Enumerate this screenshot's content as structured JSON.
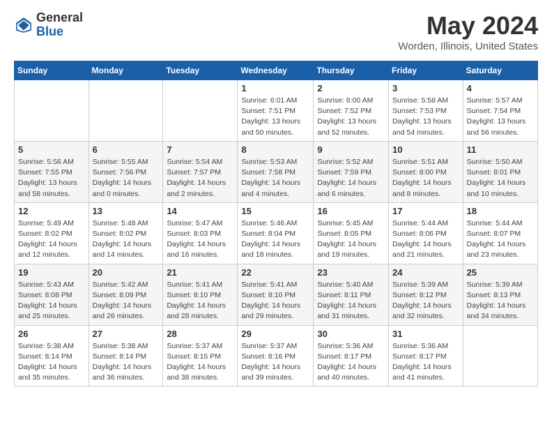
{
  "logo": {
    "general": "General",
    "blue": "Blue"
  },
  "title": "May 2024",
  "location": "Worden, Illinois, United States",
  "days_of_week": [
    "Sunday",
    "Monday",
    "Tuesday",
    "Wednesday",
    "Thursday",
    "Friday",
    "Saturday"
  ],
  "weeks": [
    [
      {
        "day": "",
        "detail": ""
      },
      {
        "day": "",
        "detail": ""
      },
      {
        "day": "",
        "detail": ""
      },
      {
        "day": "1",
        "detail": "Sunrise: 6:01 AM\nSunset: 7:51 PM\nDaylight: 13 hours\nand 50 minutes."
      },
      {
        "day": "2",
        "detail": "Sunrise: 6:00 AM\nSunset: 7:52 PM\nDaylight: 13 hours\nand 52 minutes."
      },
      {
        "day": "3",
        "detail": "Sunrise: 5:58 AM\nSunset: 7:53 PM\nDaylight: 13 hours\nand 54 minutes."
      },
      {
        "day": "4",
        "detail": "Sunrise: 5:57 AM\nSunset: 7:54 PM\nDaylight: 13 hours\nand 56 minutes."
      }
    ],
    [
      {
        "day": "5",
        "detail": "Sunrise: 5:56 AM\nSunset: 7:55 PM\nDaylight: 13 hours\nand 58 minutes."
      },
      {
        "day": "6",
        "detail": "Sunrise: 5:55 AM\nSunset: 7:56 PM\nDaylight: 14 hours\nand 0 minutes."
      },
      {
        "day": "7",
        "detail": "Sunrise: 5:54 AM\nSunset: 7:57 PM\nDaylight: 14 hours\nand 2 minutes."
      },
      {
        "day": "8",
        "detail": "Sunrise: 5:53 AM\nSunset: 7:58 PM\nDaylight: 14 hours\nand 4 minutes."
      },
      {
        "day": "9",
        "detail": "Sunrise: 5:52 AM\nSunset: 7:59 PM\nDaylight: 14 hours\nand 6 minutes."
      },
      {
        "day": "10",
        "detail": "Sunrise: 5:51 AM\nSunset: 8:00 PM\nDaylight: 14 hours\nand 8 minutes."
      },
      {
        "day": "11",
        "detail": "Sunrise: 5:50 AM\nSunset: 8:01 PM\nDaylight: 14 hours\nand 10 minutes."
      }
    ],
    [
      {
        "day": "12",
        "detail": "Sunrise: 5:49 AM\nSunset: 8:02 PM\nDaylight: 14 hours\nand 12 minutes."
      },
      {
        "day": "13",
        "detail": "Sunrise: 5:48 AM\nSunset: 8:02 PM\nDaylight: 14 hours\nand 14 minutes."
      },
      {
        "day": "14",
        "detail": "Sunrise: 5:47 AM\nSunset: 8:03 PM\nDaylight: 14 hours\nand 16 minutes."
      },
      {
        "day": "15",
        "detail": "Sunrise: 5:46 AM\nSunset: 8:04 PM\nDaylight: 14 hours\nand 18 minutes."
      },
      {
        "day": "16",
        "detail": "Sunrise: 5:45 AM\nSunset: 8:05 PM\nDaylight: 14 hours\nand 19 minutes."
      },
      {
        "day": "17",
        "detail": "Sunrise: 5:44 AM\nSunset: 8:06 PM\nDaylight: 14 hours\nand 21 minutes."
      },
      {
        "day": "18",
        "detail": "Sunrise: 5:44 AM\nSunset: 8:07 PM\nDaylight: 14 hours\nand 23 minutes."
      }
    ],
    [
      {
        "day": "19",
        "detail": "Sunrise: 5:43 AM\nSunset: 8:08 PM\nDaylight: 14 hours\nand 25 minutes."
      },
      {
        "day": "20",
        "detail": "Sunrise: 5:42 AM\nSunset: 8:09 PM\nDaylight: 14 hours\nand 26 minutes."
      },
      {
        "day": "21",
        "detail": "Sunrise: 5:41 AM\nSunset: 8:10 PM\nDaylight: 14 hours\nand 28 minutes."
      },
      {
        "day": "22",
        "detail": "Sunrise: 5:41 AM\nSunset: 8:10 PM\nDaylight: 14 hours\nand 29 minutes."
      },
      {
        "day": "23",
        "detail": "Sunrise: 5:40 AM\nSunset: 8:11 PM\nDaylight: 14 hours\nand 31 minutes."
      },
      {
        "day": "24",
        "detail": "Sunrise: 5:39 AM\nSunset: 8:12 PM\nDaylight: 14 hours\nand 32 minutes."
      },
      {
        "day": "25",
        "detail": "Sunrise: 5:39 AM\nSunset: 8:13 PM\nDaylight: 14 hours\nand 34 minutes."
      }
    ],
    [
      {
        "day": "26",
        "detail": "Sunrise: 5:38 AM\nSunset: 8:14 PM\nDaylight: 14 hours\nand 35 minutes."
      },
      {
        "day": "27",
        "detail": "Sunrise: 5:38 AM\nSunset: 8:14 PM\nDaylight: 14 hours\nand 36 minutes."
      },
      {
        "day": "28",
        "detail": "Sunrise: 5:37 AM\nSunset: 8:15 PM\nDaylight: 14 hours\nand 38 minutes."
      },
      {
        "day": "29",
        "detail": "Sunrise: 5:37 AM\nSunset: 8:16 PM\nDaylight: 14 hours\nand 39 minutes."
      },
      {
        "day": "30",
        "detail": "Sunrise: 5:36 AM\nSunset: 8:17 PM\nDaylight: 14 hours\nand 40 minutes."
      },
      {
        "day": "31",
        "detail": "Sunrise: 5:36 AM\nSunset: 8:17 PM\nDaylight: 14 hours\nand 41 minutes."
      },
      {
        "day": "",
        "detail": ""
      }
    ]
  ]
}
